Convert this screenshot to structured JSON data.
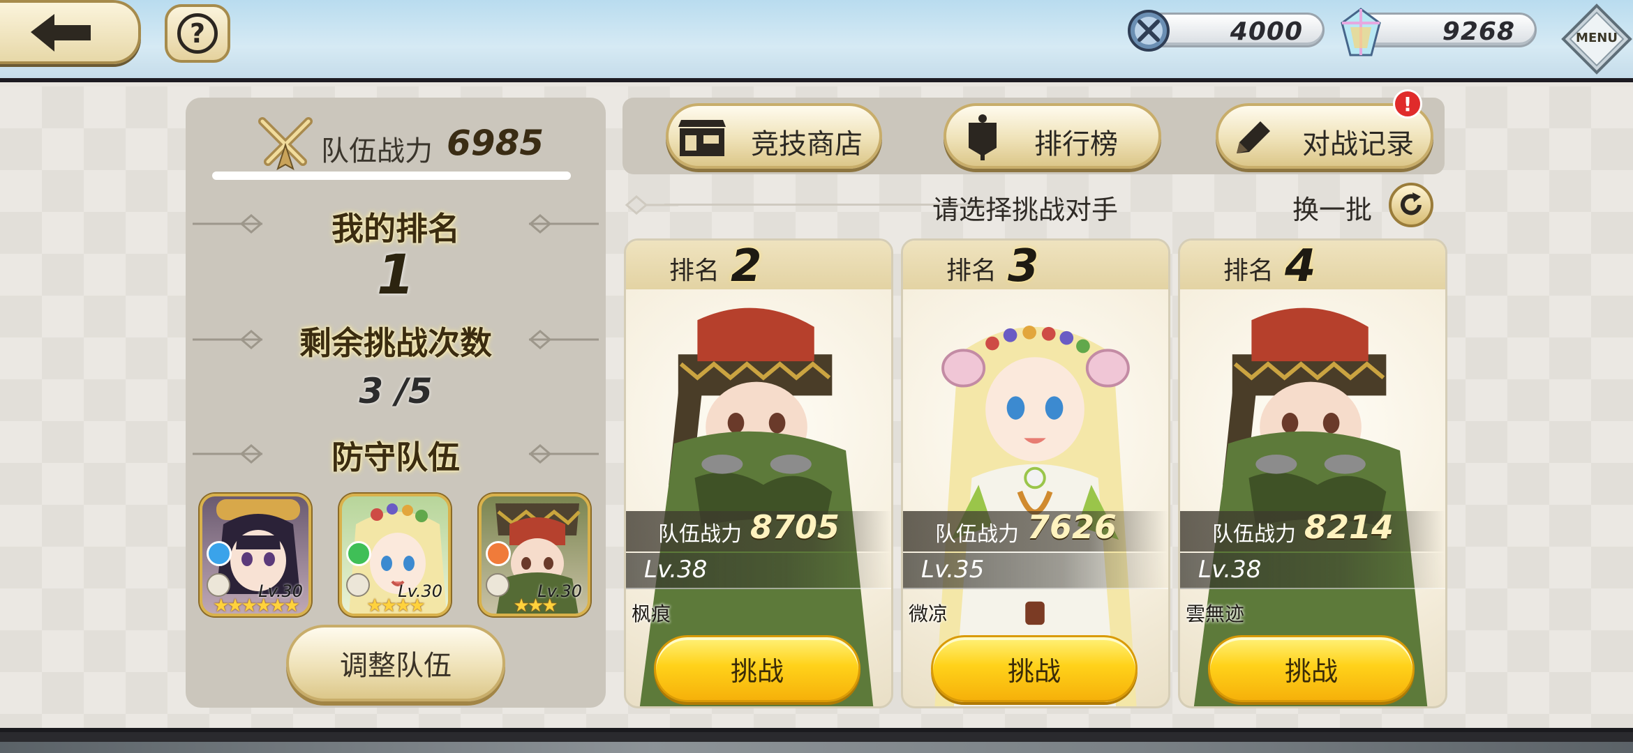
{
  "topbar": {
    "stamina": "4000",
    "gems": "9268",
    "menu_label": "MENU"
  },
  "left": {
    "team_power_label": "队伍战力",
    "team_power": "6985",
    "my_rank_title": "我的排名",
    "my_rank": "1",
    "remaining_title": "剩余挑战次数",
    "remaining": "3 /5",
    "defense_title": "防守队伍",
    "heroes": [
      {
        "level": "Lv.30",
        "stars": "★★★★★★",
        "element_color": "#3aa3ea",
        "element": "water"
      },
      {
        "level": "Lv.30",
        "stars": "★★★★",
        "element_color": "#3fbf57",
        "element": "wind"
      },
      {
        "level": "Lv.30",
        "stars": "★★★",
        "element_color": "#f07b3a",
        "element": "fire"
      }
    ],
    "adjust_label": "调整队伍"
  },
  "tabs": {
    "shop": "竞技商店",
    "ranking": "排行榜",
    "records": "对战记录",
    "records_badge": "!"
  },
  "select": {
    "prompt": "请选择挑战对手",
    "refresh": "换一批"
  },
  "cards": [
    {
      "rank_label": "排名",
      "rank": "2",
      "power_label": "队伍战力",
      "power": "8705",
      "level": "Lv.38",
      "name": "枫痕",
      "challenge": "挑战"
    },
    {
      "rank_label": "排名",
      "rank": "3",
      "power_label": "队伍战力",
      "power": "7626",
      "level": "Lv.35",
      "name": "微凉",
      "challenge": "挑战"
    },
    {
      "rank_label": "排名",
      "rank": "4",
      "power_label": "队伍战力",
      "power": "8214",
      "level": "Lv.38",
      "name": "雲無迹",
      "challenge": "挑战"
    }
  ],
  "colors": {
    "accent_gold": "#d9b24c",
    "challenge_yellow": "#ffd21a"
  }
}
